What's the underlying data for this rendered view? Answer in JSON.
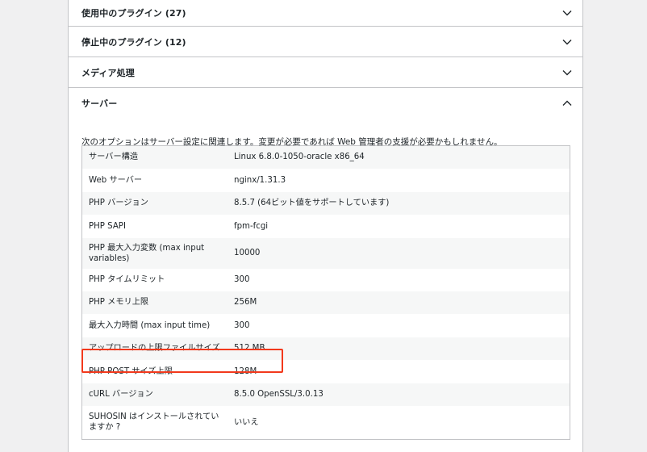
{
  "accordion": {
    "sections": [
      {
        "title": "使用中のプラグイン (27)",
        "expanded": false,
        "chevron_icon": "chevron-down-icon"
      },
      {
        "title": "停止中のプラグイン (12)",
        "expanded": false,
        "chevron_icon": "chevron-down-icon"
      },
      {
        "title": "メディア処理",
        "expanded": false,
        "chevron_icon": "chevron-down-icon"
      },
      {
        "title": "サーバー",
        "expanded": true,
        "chevron_icon": "chevron-up-icon"
      }
    ]
  },
  "server": {
    "description": "次のオプションはサーバー設定に関連します。変更が必要であれば Web 管理者の支援が必要かもしれません。",
    "rows": [
      {
        "key": "サーバー構造",
        "value": "Linux 6.8.0-1050-oracle x86_64"
      },
      {
        "key": "Web サーバー",
        "value": "nginx/1.31.3"
      },
      {
        "key": "PHP バージョン",
        "value": "8.5.7 (64ビット値をサポートしています)"
      },
      {
        "key": "PHP SAPI",
        "value": "fpm-fcgi"
      },
      {
        "key": "PHP 最大入力変数 (max input variables)",
        "value": "10000"
      },
      {
        "key": "PHP タイムリミット",
        "value": "300"
      },
      {
        "key": "PHP メモリ上限",
        "value": "256M"
      },
      {
        "key": "最大入力時間 (max input time)",
        "value": "300"
      },
      {
        "key": "アップロードの上限ファイルサイズ",
        "value": "512 MB"
      },
      {
        "key": "PHP POST サイズ上限",
        "value": "128M"
      },
      {
        "key": "cURL バージョン",
        "value": "8.5.0 OpenSSL/3.0.13"
      },
      {
        "key": "SUHOSIN はインストールされていますか ?",
        "value": "いいえ"
      }
    ]
  },
  "colors": {
    "highlight_border": "#f2391c",
    "border": "#c3c4c7",
    "stripe": "#f6f7f7"
  }
}
